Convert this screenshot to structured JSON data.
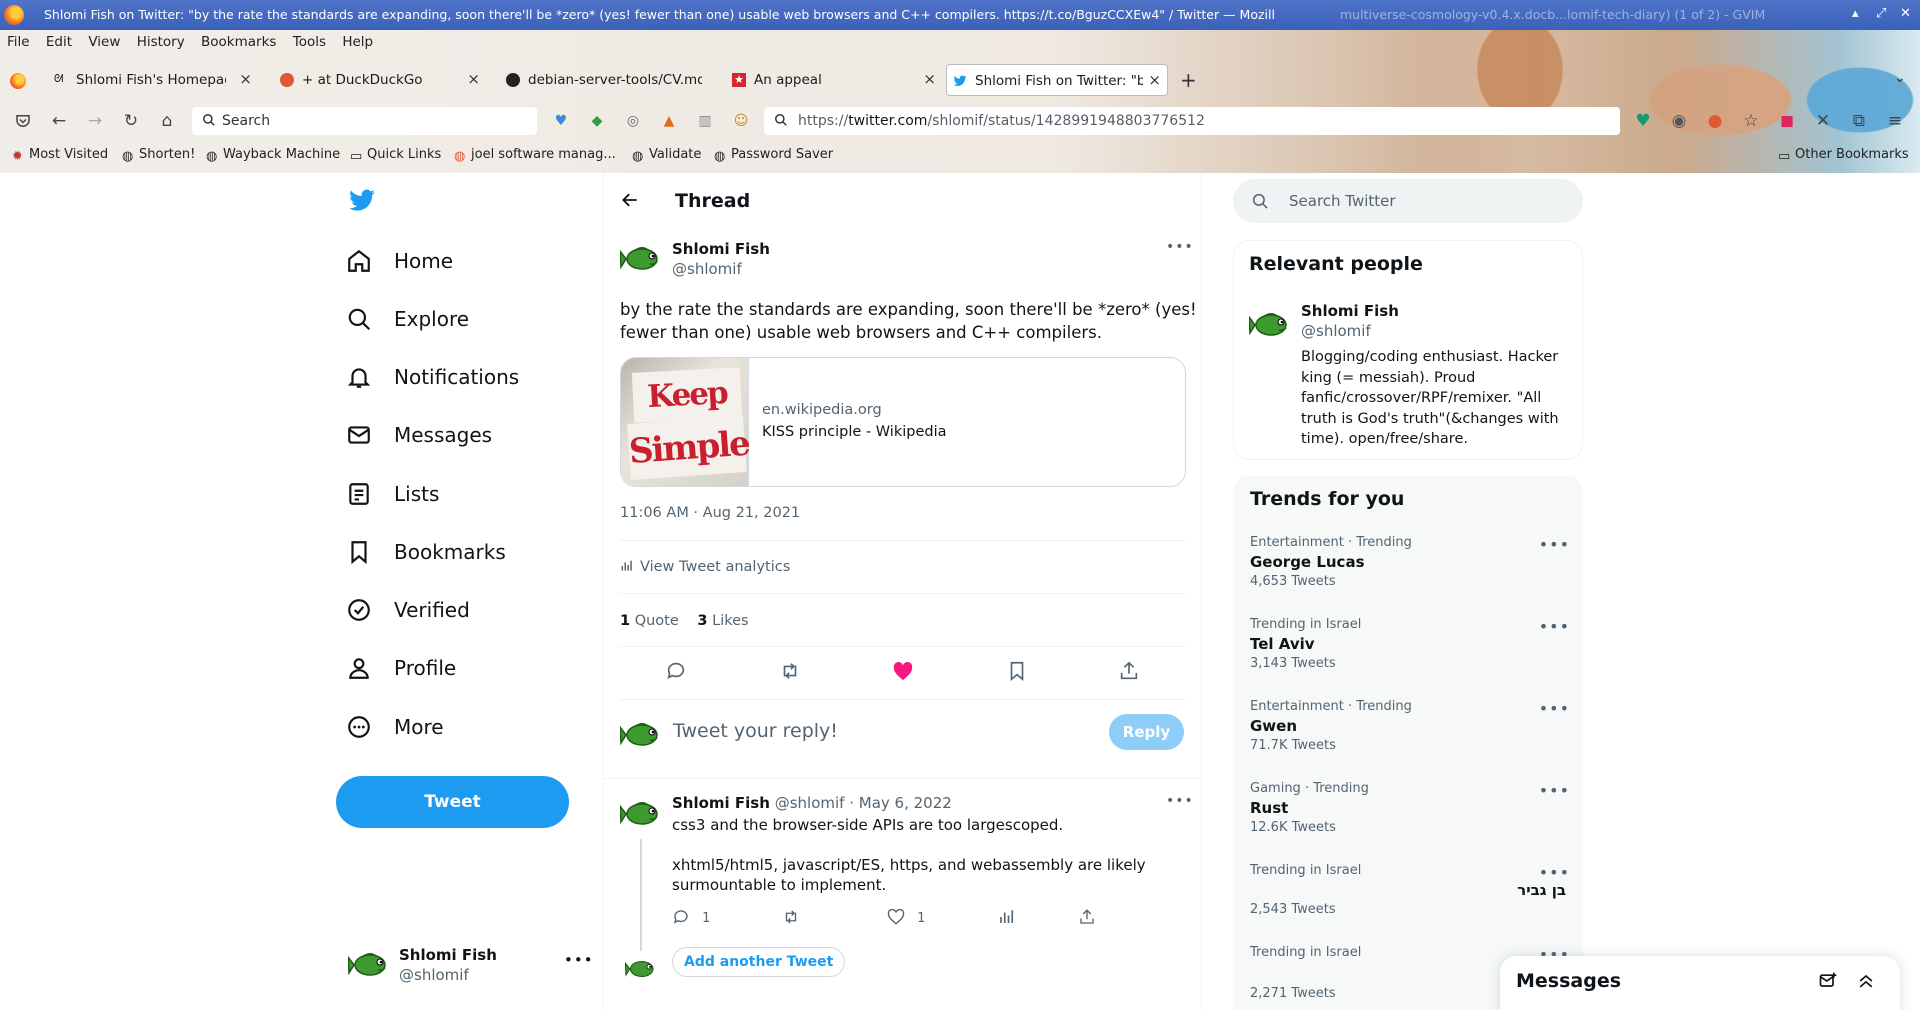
{
  "window": {
    "title": "Shlomi Fish on Twitter: \"by the rate the standards are expanding, soon there'll be *zero* (yes! fewer than one) usable web browsers and C++ compilers. https://t.co/BguzCCXEw4\" / Twitter — Mozilla Firefox",
    "background_window_title": "multiverse-cosmology-v0.4.x.docb...lomif-tech-diary) (1 of 2) - GVIM"
  },
  "menu": [
    "File",
    "Edit",
    "View",
    "History",
    "Bookmarks",
    "Tools",
    "Help"
  ],
  "tabs": [
    {
      "label": "Shlomi Fish's Homepage: H",
      "icon": "sf-icon"
    },
    {
      "label": "+ at DuckDuckGo",
      "icon": "duckduckgo-icon"
    },
    {
      "label": "debian-server-tools/CV.md",
      "icon": "github-icon"
    },
    {
      "label": "An appeal",
      "icon": "star-icon"
    },
    {
      "label": "Shlomi Fish on Twitter: \"by",
      "icon": "twitter-icon",
      "active": true
    }
  ],
  "navbar": {
    "search_placeholder": "Search",
    "url_prefix": "https://",
    "url_host": "twitter.com",
    "url_path": "/shlomif/status/1428991948803776512"
  },
  "bookmarks": [
    "Most Visited",
    "Shorten!",
    "Wayback Machine",
    "Quick Links",
    "joel software manag...",
    "Validate",
    "Password Saver"
  ],
  "other_bookmarks": "Other Bookmarks",
  "sidebar": {
    "items": [
      "Home",
      "Explore",
      "Notifications",
      "Messages",
      "Lists",
      "Bookmarks",
      "Verified",
      "Profile",
      "More"
    ],
    "tweet_button": "Tweet",
    "account_name": "Shlomi Fish",
    "account_handle": "@shlomif"
  },
  "thread": {
    "header": "Thread",
    "author_name": "Shlomi Fish",
    "author_handle": "@shlomif",
    "text_line1": "by the rate the standards are expanding, soon there'll be  *zero* (yes!",
    "text_line2": "fewer than one) usable web browsers and C++ compilers.",
    "card_image_line1": "Keep it",
    "card_image_line2": "Simple",
    "card_domain": "en.wikipedia.org",
    "card_title": "KISS principle - Wikipedia",
    "timestamp": "11:06 AM · Aug 21, 2021",
    "analytics": "View Tweet analytics",
    "quote_count": "1",
    "quote_label": "Quote",
    "like_count": "3",
    "like_label": "Likes",
    "reply_placeholder": "Tweet your reply!",
    "reply_button": "Reply"
  },
  "reply_tweet": {
    "author_name": "Shlomi Fish",
    "author_handle": "@shlomif",
    "date": "· May 6, 2022",
    "line1": "css3 and the browser-side APIs are too largescoped.",
    "line2": "xhtml5/html5, javascript/ES, https, and webassembly are likely",
    "line3": "surmountable to implement.",
    "reply_count": "1",
    "like_count": "1",
    "add_another": "Add another Tweet"
  },
  "right": {
    "search_placeholder": "Search Twitter",
    "relevant_title": "Relevant people",
    "person_name": "Shlomi Fish",
    "person_handle": "@shlomif",
    "person_bio": [
      "Blogging/coding enthusiast. Hacker",
      "king (= messiah). Proud",
      "fanfic/crossover/RPF/remixer. \"All",
      "truth is God's truth\"(&changes with",
      "time). open/free/share."
    ],
    "trends_title": "Trends for you",
    "trends": [
      {
        "category": "Entertainment · Trending",
        "name": "George Lucas",
        "count": "4,653 Tweets"
      },
      {
        "category": "Trending in Israel",
        "name": "Tel Aviv",
        "count": "3,143 Tweets"
      },
      {
        "category": "Entertainment · Trending",
        "name": "Gwen",
        "count": "71.7K Tweets"
      },
      {
        "category": "Gaming · Trending",
        "name": "Rust",
        "count": "12.6K Tweets"
      },
      {
        "category": "Trending in Israel",
        "name": "בן גביר",
        "count": "2,543 Tweets"
      },
      {
        "category": "Trending in Israel",
        "name": "",
        "count": "2,271 Tweets"
      }
    ],
    "messages_dock": "Messages"
  },
  "colors": {
    "twitter_blue": "#1d9bf0",
    "like_pink": "#f91880",
    "titlebar": "#3b60b8"
  }
}
